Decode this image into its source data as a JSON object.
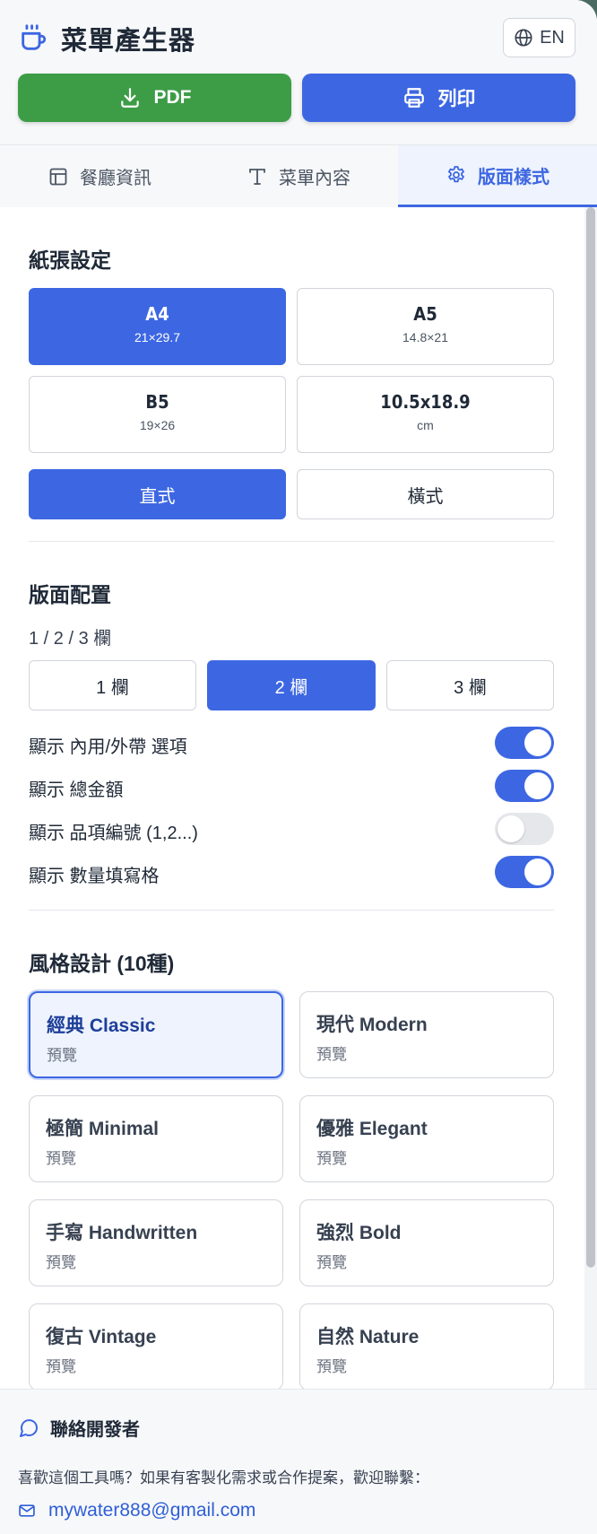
{
  "header": {
    "title": "菜單產生器",
    "language_label": "EN",
    "pdf_label": "PDF",
    "print_label": "列印"
  },
  "tabs": [
    {
      "label": "餐廳資訊",
      "icon": "layout-icon"
    },
    {
      "label": "菜單內容",
      "icon": "text-icon"
    },
    {
      "label": "版面樣式",
      "icon": "gear-icon",
      "active": true
    }
  ],
  "paper": {
    "title": "紙張設定",
    "sizes": [
      {
        "name": "A4",
        "size": "21×29.7",
        "active": true
      },
      {
        "name": "A5",
        "size": "14.8×21"
      },
      {
        "name": "B5",
        "size": "19×26"
      },
      {
        "name": "10.5x18.9",
        "size": "cm"
      }
    ],
    "orientation": {
      "portrait": "直式",
      "landscape": "橫式",
      "selected": "直式"
    }
  },
  "layout": {
    "title": "版面配置",
    "columns_label": "1 / 2 / 3 欄",
    "columns": [
      "1 欄",
      "2 欄",
      "3 欄"
    ],
    "selected_column": "2 欄",
    "toggles": [
      {
        "label": "顯示 內用/外帶 選項",
        "on": true
      },
      {
        "label": "顯示 總金額",
        "on": true
      },
      {
        "label": "顯示 品項編號 (1,2...)",
        "on": false
      },
      {
        "label": "顯示 數量填寫格",
        "on": true
      }
    ]
  },
  "styles": {
    "title": "風格設計 (10種)",
    "preview_label": "預覽",
    "items": [
      {
        "name": "經典 Classic",
        "active": true
      },
      {
        "name": "現代 Modern"
      },
      {
        "name": "極簡 Minimal"
      },
      {
        "name": "優雅 Elegant"
      },
      {
        "name": "手寫 Handwritten"
      },
      {
        "name": "強烈 Bold"
      },
      {
        "name": "復古 Vintage"
      },
      {
        "name": "自然 Nature"
      }
    ]
  },
  "footer": {
    "title": "聯絡開發者",
    "description": "喜歡這個工具嗎？如果有客製化需求或合作提案，歡迎聯繫：",
    "email": "mywater888@gmail.com"
  },
  "colors": {
    "primary": "#3d67e2",
    "success": "#3d9d47",
    "active_tab_bg": "#eef3fd"
  }
}
